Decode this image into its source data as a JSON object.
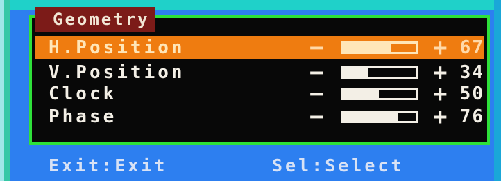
{
  "menu": {
    "title": "Geometry",
    "items": [
      {
        "label": "H.Position",
        "value": "67",
        "level": 0.67,
        "selected": true
      },
      {
        "label": "V.Position",
        "value": "34",
        "level": 0.34,
        "selected": false
      },
      {
        "label": "Clock",
        "value": "50",
        "level": 0.5,
        "selected": false
      },
      {
        "label": "Phase",
        "value": "76",
        "level": 0.76,
        "selected": false
      }
    ],
    "decrease_symbol": "−",
    "increase_symbol": "+"
  },
  "footer": {
    "exit_hint": "Exit:Exit",
    "select_hint": "Sel:Select"
  },
  "colors": {
    "highlight": "#ef7c10",
    "panel_border": "#2ee03a",
    "background": "#2d7ff0",
    "title_bg": "#7c1b18"
  }
}
